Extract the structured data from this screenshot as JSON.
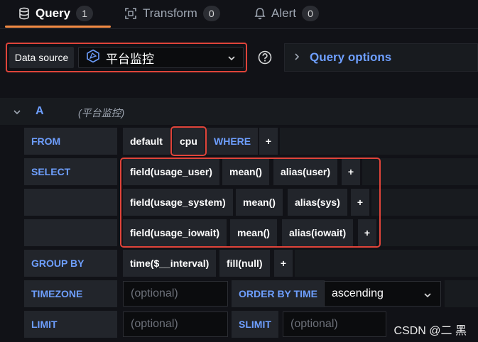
{
  "tabs": [
    {
      "label": "Query",
      "count": "1",
      "icon": "database-icon",
      "active": true
    },
    {
      "label": "Transform",
      "count": "0",
      "icon": "transform-icon",
      "active": false
    },
    {
      "label": "Alert",
      "count": "0",
      "icon": "bell-icon",
      "active": false
    }
  ],
  "datasource": {
    "label": "Data source",
    "selected": "平台监控",
    "icon": "datasource-logo-icon"
  },
  "query_options": {
    "label": "Query options"
  },
  "query": {
    "letter": "A",
    "datasource_note": "(平台监控)"
  },
  "builder": {
    "from": {
      "label": "FROM",
      "policy": "default",
      "measurement": "cpu",
      "where_label": "WHERE",
      "add": "+"
    },
    "select": {
      "label": "SELECT",
      "rows": [
        {
          "field": "field(usage_user)",
          "agg": "mean()",
          "alias": "alias(user)",
          "add": "+"
        },
        {
          "field": "field(usage_system)",
          "agg": "mean()",
          "alias": "alias(sys)",
          "add": "+"
        },
        {
          "field": "field(usage_iowait)",
          "agg": "mean()",
          "alias": "alias(iowait)",
          "add": "+"
        }
      ]
    },
    "group_by": {
      "label": "GROUP BY",
      "time": "time($__interval)",
      "fill": "fill(null)",
      "add": "+"
    },
    "timezone": {
      "label": "TIMEZONE",
      "placeholder": "(optional)",
      "order_label": "ORDER BY TIME",
      "order_value": "ascending"
    },
    "limit": {
      "label": "LIMIT",
      "placeholder": "(optional)",
      "slimit_label": "SLIMIT",
      "slimit_placeholder": "(optional)"
    }
  },
  "watermark": "CSDN @二 黑",
  "colors": {
    "accent": "#6e9fff",
    "active_tab": "#f28b45",
    "highlight": "#e0443a"
  }
}
